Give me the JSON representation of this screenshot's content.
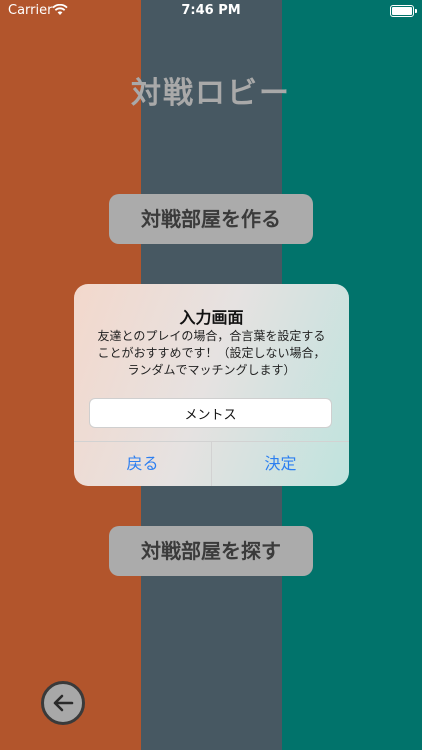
{
  "status_bar": {
    "carrier": "Carrier",
    "time": "7:46 PM"
  },
  "lobby": {
    "title": "対戦ロビー",
    "create_room_label": "対戦部屋を作る",
    "search_room_label": "対戦部屋を探す"
  },
  "dialog": {
    "title": "入力画面",
    "message": "友達とのプレイの場合，合言葉を設定する\nことがおすすめです！（設定しない場合，\nランダムでマッチングします）",
    "input_value": "メントス",
    "cancel_label": "戻る",
    "confirm_label": "決定"
  },
  "colors": {
    "left_panel": "#b2552c",
    "middle_panel": "#475862",
    "right_panel": "#01736b",
    "button_bg": "#ababab",
    "link_blue": "#2d7ff0"
  },
  "icons": {
    "wifi": "wifi-icon",
    "battery": "battery-icon",
    "back": "arrow-left-icon"
  }
}
